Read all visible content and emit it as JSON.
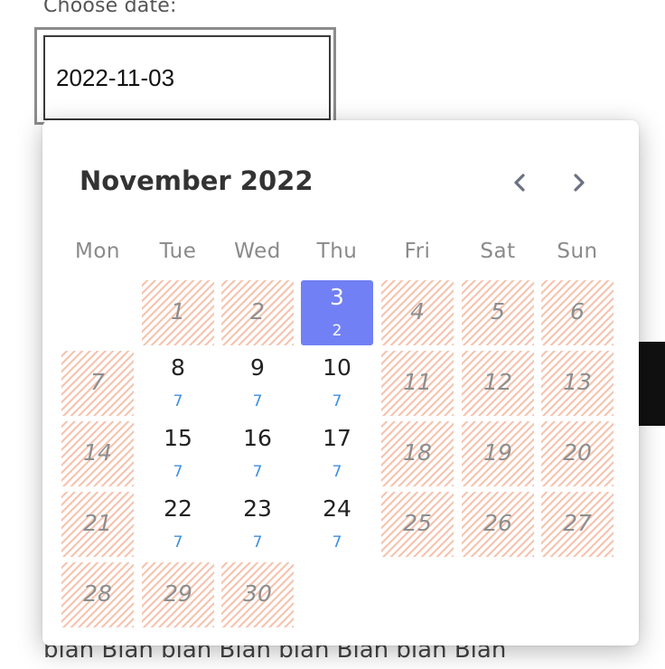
{
  "field": {
    "label": "Choose date:",
    "value": "2022-11-03"
  },
  "calendar": {
    "title": "November 2022",
    "weekdays": [
      "Mon",
      "Tue",
      "Wed",
      "Thu",
      "Fri",
      "Sat",
      "Sun"
    ],
    "days": [
      {
        "day": "1",
        "state": "disabled"
      },
      {
        "day": "2",
        "state": "disabled"
      },
      {
        "day": "3",
        "state": "selected",
        "count": "2"
      },
      {
        "day": "4",
        "state": "disabled"
      },
      {
        "day": "5",
        "state": "disabled"
      },
      {
        "day": "6",
        "state": "disabled"
      },
      {
        "day": "7",
        "state": "disabled"
      },
      {
        "day": "8",
        "state": "available",
        "count": "7"
      },
      {
        "day": "9",
        "state": "available",
        "count": "7"
      },
      {
        "day": "10",
        "state": "available",
        "count": "7"
      },
      {
        "day": "11",
        "state": "disabled"
      },
      {
        "day": "12",
        "state": "disabled"
      },
      {
        "day": "13",
        "state": "disabled"
      },
      {
        "day": "14",
        "state": "disabled"
      },
      {
        "day": "15",
        "state": "available",
        "count": "7"
      },
      {
        "day": "16",
        "state": "available",
        "count": "7"
      },
      {
        "day": "17",
        "state": "available",
        "count": "7"
      },
      {
        "day": "18",
        "state": "disabled"
      },
      {
        "day": "19",
        "state": "disabled"
      },
      {
        "day": "20",
        "state": "disabled"
      },
      {
        "day": "21",
        "state": "disabled"
      },
      {
        "day": "22",
        "state": "available",
        "count": "7"
      },
      {
        "day": "23",
        "state": "available",
        "count": "7"
      },
      {
        "day": "24",
        "state": "available",
        "count": "7"
      },
      {
        "day": "25",
        "state": "disabled"
      },
      {
        "day": "26",
        "state": "disabled"
      },
      {
        "day": "27",
        "state": "disabled"
      },
      {
        "day": "28",
        "state": "disabled"
      },
      {
        "day": "29",
        "state": "disabled"
      },
      {
        "day": "30",
        "state": "disabled"
      }
    ]
  },
  "nav": {
    "prev_icon": "chevron-left-icon",
    "next_icon": "chevron-right-icon"
  },
  "colors": {
    "selected_bg": "#7180f4",
    "count_text": "#3d8fe0",
    "disabled_stripe": "#f6c4b0"
  },
  "footer_text": "blah Blah blah Blah blah Blah blah Blah"
}
